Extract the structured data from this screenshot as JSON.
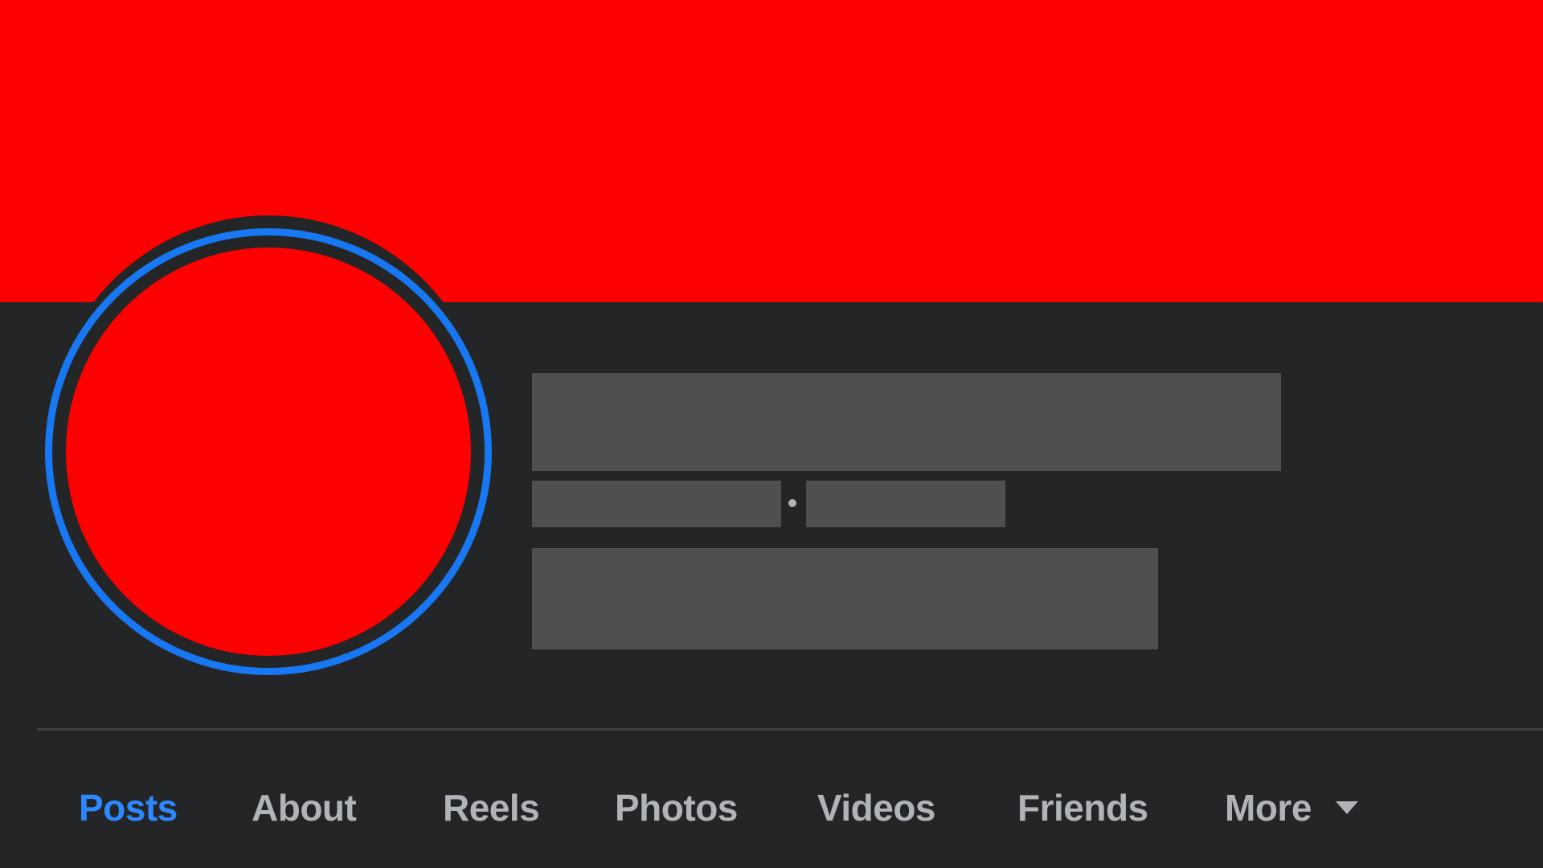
{
  "colors": {
    "cover": "#ff0000",
    "avatar": "#ff0000",
    "avatar_ring": "#1877f2",
    "background": "#242526",
    "active_tab": "#2d88ff",
    "inactive_tab": "#b0b3b8"
  },
  "profile": {
    "meta_separator": "·"
  },
  "tabs": {
    "posts": "Posts",
    "about": "About",
    "reels": "Reels",
    "photos": "Photos",
    "videos": "Videos",
    "friends": "Friends",
    "more": "More"
  },
  "active_tab": "posts",
  "icons": {
    "more_caret": "caret-down-icon"
  }
}
